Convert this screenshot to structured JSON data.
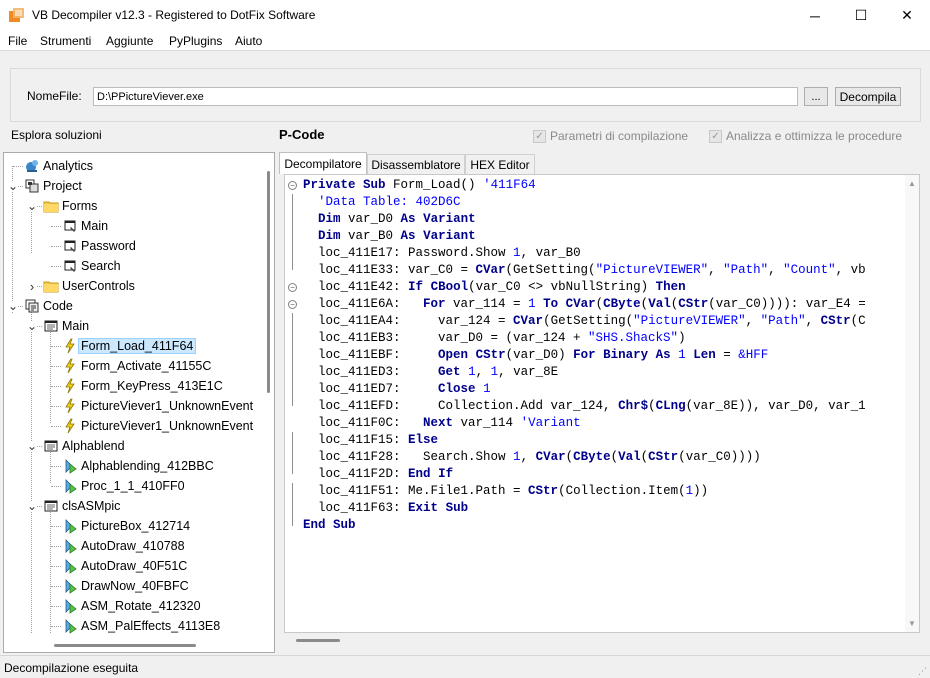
{
  "window": {
    "title": "VB Decompiler v12.3 - Registered to DotFix Software",
    "minimize_glyph": "─",
    "maximize_glyph": "☐",
    "close_glyph": "✕"
  },
  "menu": [
    "File",
    "Strumenti",
    "Aggiunte",
    "PyPlugins",
    "Aiuto"
  ],
  "file": {
    "label": "NomeFile:",
    "value": "D:\\PPictureViever.exe",
    "browse_label": "...",
    "decompile_label": "Decompila"
  },
  "solution_label": "Esplora soluzioni",
  "pcode_label": "P-Code",
  "options": {
    "params_label": "Parametri di compilazione",
    "analyze_label": "Analizza e ottimizza le procedure",
    "check_glyph": "✓"
  },
  "tree": [
    {
      "label": "Analytics",
      "icon": "analytics-icon"
    },
    {
      "label": "Project",
      "icon": "project-icon"
    },
    {
      "label": "Forms",
      "icon": "folder-icon"
    },
    {
      "label": "Main",
      "icon": "form-icon"
    },
    {
      "label": "Password",
      "icon": "form-icon"
    },
    {
      "label": "Search",
      "icon": "form-icon"
    },
    {
      "label": "UserControls",
      "icon": "folder-icon"
    },
    {
      "label": "Code",
      "icon": "code-icon"
    },
    {
      "label": "Main",
      "icon": "module-icon"
    },
    {
      "label": "Form_Load_411F64",
      "icon": "event-icon"
    },
    {
      "label": "Form_Activate_41155C",
      "icon": "event-icon"
    },
    {
      "label": "Form_KeyPress_413E1C",
      "icon": "event-icon"
    },
    {
      "label": "PictureViever1_UnknownEvent",
      "icon": "event-icon"
    },
    {
      "label": "PictureViever1_UnknownEvent",
      "icon": "event-icon"
    },
    {
      "label": "Alphablend",
      "icon": "module-icon"
    },
    {
      "label": "Alphablending_412BBC",
      "icon": "method-icon"
    },
    {
      "label": "Proc_1_1_410FF0",
      "icon": "method-icon"
    },
    {
      "label": "clsASMpic",
      "icon": "module-icon"
    },
    {
      "label": "PictureBox_412714",
      "icon": "method-icon"
    },
    {
      "label": "AutoDraw_410788",
      "icon": "method-icon"
    },
    {
      "label": "AutoDraw_40F51C",
      "icon": "method-icon"
    },
    {
      "label": "DrawNow_40FBFC",
      "icon": "method-icon"
    },
    {
      "label": "ASM_Rotate_412320",
      "icon": "method-icon"
    },
    {
      "label": "ASM_PalEffects_4113E8",
      "icon": "method-icon"
    }
  ],
  "tabs": [
    "Decompilatore",
    "Disassemblatore",
    "HEX Editor"
  ],
  "code_lines": [
    "Private Sub Form_Load() '411F64",
    "  'Data Table: 402D6C",
    "  Dim var_D0 As Variant",
    "  Dim var_B0 As Variant",
    "  loc_411E17: Password.Show 1, var_B0",
    "  loc_411E33: var_C0 = CVar(GetSetting(\"PictureVIEWER\", \"Path\", \"Count\", vb",
    "  loc_411E42: If CBool(var_C0 <> vbNullString) Then",
    "  loc_411E6A:   For var_114 = 1 To CVar(CByte(Val(CStr(var_C0)))): var_E4 =",
    "  loc_411EA4:     var_124 = CVar(GetSetting(\"PictureVIEWER\", \"Path\", CStr(C",
    "  loc_411EB3:     var_D0 = (var_124 + \"SHS.ShackS\")",
    "  loc_411EBF:     Open CStr(var_D0) For Binary As 1 Len = &HFF",
    "  loc_411ED3:     Get 1, 1, var_8E",
    "  loc_411ED7:     Close 1",
    "  loc_411EFD:     Collection.Add var_124, Chr$(CLng(var_8E)), var_D0, var_1",
    "  loc_411F0C:   Next var_114 'Variant",
    "  loc_411F15: Else",
    "  loc_411F28:   Search.Show 1, CVar(CByte(Val(CStr(var_C0))))",
    "  loc_411F2D: End If",
    "  loc_411F51: Me.File1.Path = CStr(Collection.Item(1))",
    "  loc_411F63: Exit Sub",
    "End Sub"
  ],
  "status": "Decompilazione eseguita"
}
